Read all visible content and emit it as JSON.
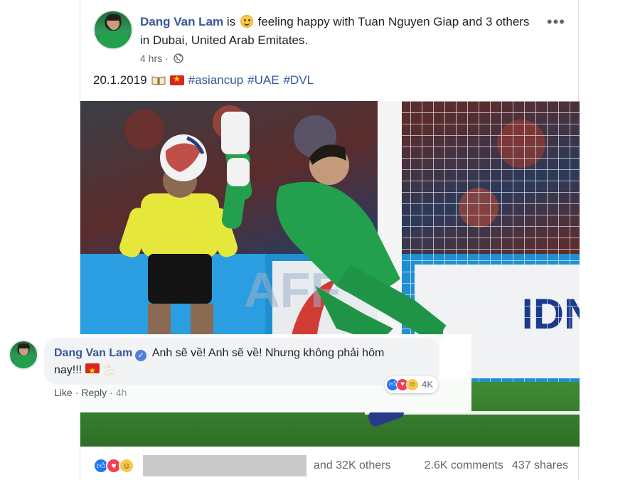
{
  "post": {
    "author": "Dang Van Lam",
    "feeling_prefix": "is",
    "feeling_text": "feeling happy with Tuan Nguyen Giap and 3 others in Dubai, United Arab Emitates.",
    "time": "4 hrs",
    "more_label": "•••",
    "date_text": "20.1.2019",
    "hashtags": [
      "#asiancup",
      "#UAE",
      "#DVL"
    ]
  },
  "photo": {
    "watermark": "AFF"
  },
  "reactions": {
    "others_text": "and 32K others",
    "comments": "2.6K comments",
    "shares": "437 shares"
  },
  "comment": {
    "author": "Dang Van Lam",
    "text_line1": "Anh sẽ về! Anh sẽ về! Nhưng không phải hôm",
    "text_line2": "nay!!!",
    "like_label": "Like",
    "reply_label": "Reply",
    "separator": "·",
    "time": "4h",
    "reaction_count": "4K"
  },
  "colors": {
    "link_blue": "#365899",
    "like_blue": "#2078f4",
    "love_red": "#f33e58",
    "haha_yellow": "#f7c948",
    "kit_green": "#22a04e",
    "referee_yellow": "#e5e83a"
  },
  "icons": [
    "smiley-icon",
    "globe-icon",
    "book-icon",
    "vietnam-flag-icon",
    "verified-icon",
    "flexed-biceps-icon",
    "like-reaction-icon",
    "love-reaction-icon",
    "haha-reaction-icon"
  ]
}
